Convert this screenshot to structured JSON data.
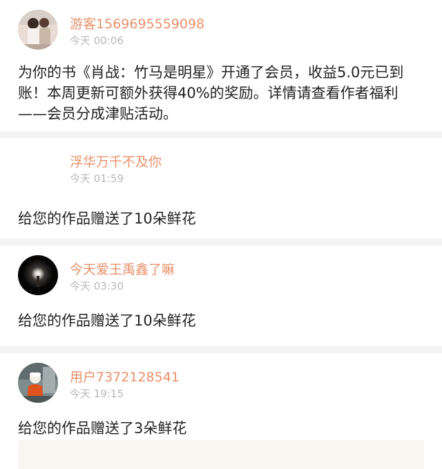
{
  "feed": {
    "items": [
      {
        "username": "游客1569695559098",
        "time": "今天 00:06",
        "message": "为你的书《肖战：竹马是明星》开通了会员，收益5.0元已到账！本周更新可额外获得40%的奖励。详情请查看作者福利——会员分成津贴活动。",
        "avatar": "avatar-photo-icon"
      },
      {
        "username": "浮华万千不及你",
        "time": "今天 01:59",
        "message": "给您的作品赠送了10朵鲜花",
        "avatar": "blank-avatar-icon"
      },
      {
        "username": "今天爱王禹鑫了嘛",
        "time": "今天 03:30",
        "message": "给您的作品赠送了10朵鲜花",
        "avatar": "night-light-avatar-icon"
      },
      {
        "username": "用户7372128541",
        "time": "今天 19:15",
        "message": "给您的作品赠送了3朵鲜花",
        "avatar": "person-avatar-icon"
      }
    ]
  },
  "colors": {
    "username": "#e8906a",
    "time": "#b8b8b8",
    "divider": "#f3f3f3",
    "reply_box": "#f7f6f1"
  }
}
